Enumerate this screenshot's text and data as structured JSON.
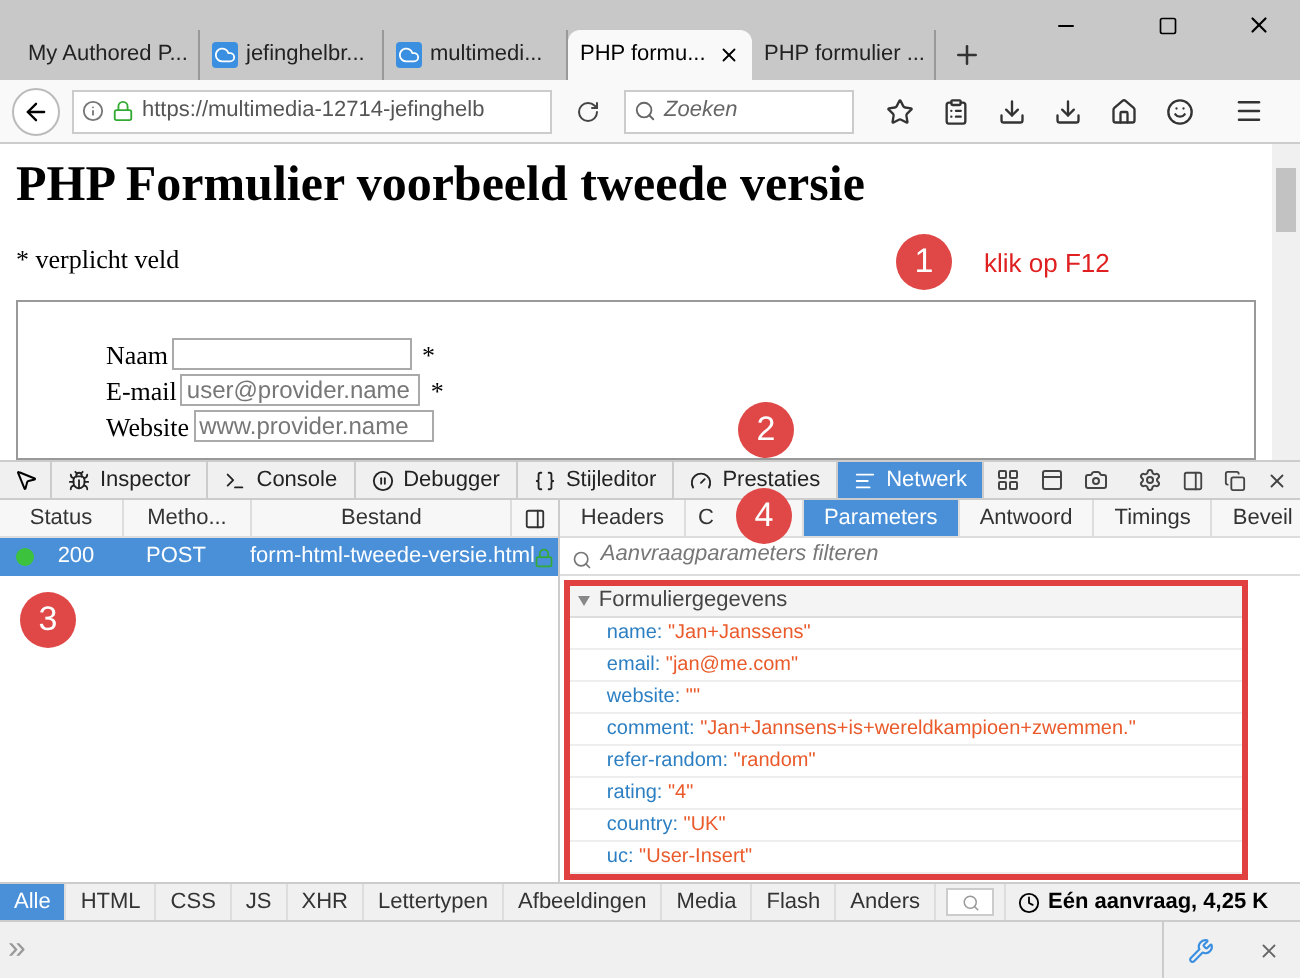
{
  "browser": {
    "tabs": [
      {
        "label": "My Authored P...",
        "selected": false,
        "kind": "plain"
      },
      {
        "label": "jefinghelbr...",
        "selected": false,
        "kind": "cloud"
      },
      {
        "label": "multimedi...",
        "selected": false,
        "kind": "cloud"
      },
      {
        "label": "PHP formu...",
        "selected": true,
        "kind": "plain"
      },
      {
        "label": "PHP formulier ...",
        "selected": false,
        "kind": "plain"
      }
    ],
    "url": "https://multimedia-12714-jefinghelb",
    "search_placeholder": "Zoeken"
  },
  "page": {
    "heading": "PHP Formulier voorbeeld tweede versie",
    "note": "* verplicht veld",
    "fields": [
      {
        "label": "Naam",
        "marker": "*"
      },
      {
        "label": "E-mail",
        "placeholder": "user@provider.name",
        "marker": "*"
      },
      {
        "label": "Website",
        "placeholder": "www.provider.name"
      }
    ]
  },
  "annotations": [
    {
      "number": "1",
      "text": "klik op F12"
    },
    {
      "number": "2"
    },
    {
      "number": "3"
    },
    {
      "number": "4"
    }
  ],
  "devtools": {
    "tools": [
      {
        "label": "Inspector",
        "selected": false,
        "kind": "inspector"
      },
      {
        "label": "Console",
        "selected": false,
        "kind": "console"
      },
      {
        "label": "Debugger",
        "selected": false,
        "kind": "debugger"
      },
      {
        "label": "Stijleditor",
        "selected": false,
        "kind": "style"
      },
      {
        "label": "Prestaties",
        "selected": false,
        "kind": "perf"
      },
      {
        "label": "Netwerk",
        "selected": true,
        "kind": "network"
      }
    ],
    "columns": [
      "Status",
      "Metho...",
      "Bestand"
    ],
    "requests": [
      {
        "status": "200",
        "method": "POST",
        "file": "form-html-tweede-versie.html",
        "selected": true
      }
    ],
    "detail_tabs": [
      {
        "label": "Headers",
        "selected": false
      },
      {
        "label": "C",
        "selected": false
      },
      {
        "label": "Parameters",
        "selected": true
      },
      {
        "label": "Antwoord",
        "selected": false
      },
      {
        "label": "Timings",
        "selected": false
      },
      {
        "label": "Beveil",
        "selected": false
      }
    ],
    "filter_placeholder": "Aanvraagparameters filteren",
    "section": {
      "title": "Formuliergegevens",
      "expanded": true,
      "params": [
        {
          "key": "name:",
          "value": "\"Jan+Janssens\""
        },
        {
          "key": "email:",
          "value": "\"jan@me.com\""
        },
        {
          "key": "website:",
          "value": "\"\""
        },
        {
          "key": "comment:",
          "value": "\"Jan+Jannsens+is+wereldkampioen+zwemmen.\""
        },
        {
          "key": "refer-random:",
          "value": "\"random\""
        },
        {
          "key": "rating:",
          "value": "\"4\""
        },
        {
          "key": "country:",
          "value": "\"UK\""
        },
        {
          "key": "uc:",
          "value": "\"User-Insert\""
        }
      ]
    },
    "type_filters": [
      {
        "label": "Alle",
        "selected": true
      },
      {
        "label": "HTML",
        "selected": false
      },
      {
        "label": "CSS",
        "selected": false
      },
      {
        "label": "JS",
        "selected": false
      },
      {
        "label": "XHR",
        "selected": false
      },
      {
        "label": "Lettertypen",
        "selected": false
      },
      {
        "label": "Afbeeldingen",
        "selected": false
      },
      {
        "label": "Media",
        "selected": false
      },
      {
        "label": "Flash",
        "selected": false
      },
      {
        "label": "Anders",
        "selected": false
      }
    ],
    "summary": "Eén aanvraag, 4,25 K",
    "console_prompt": "»"
  }
}
